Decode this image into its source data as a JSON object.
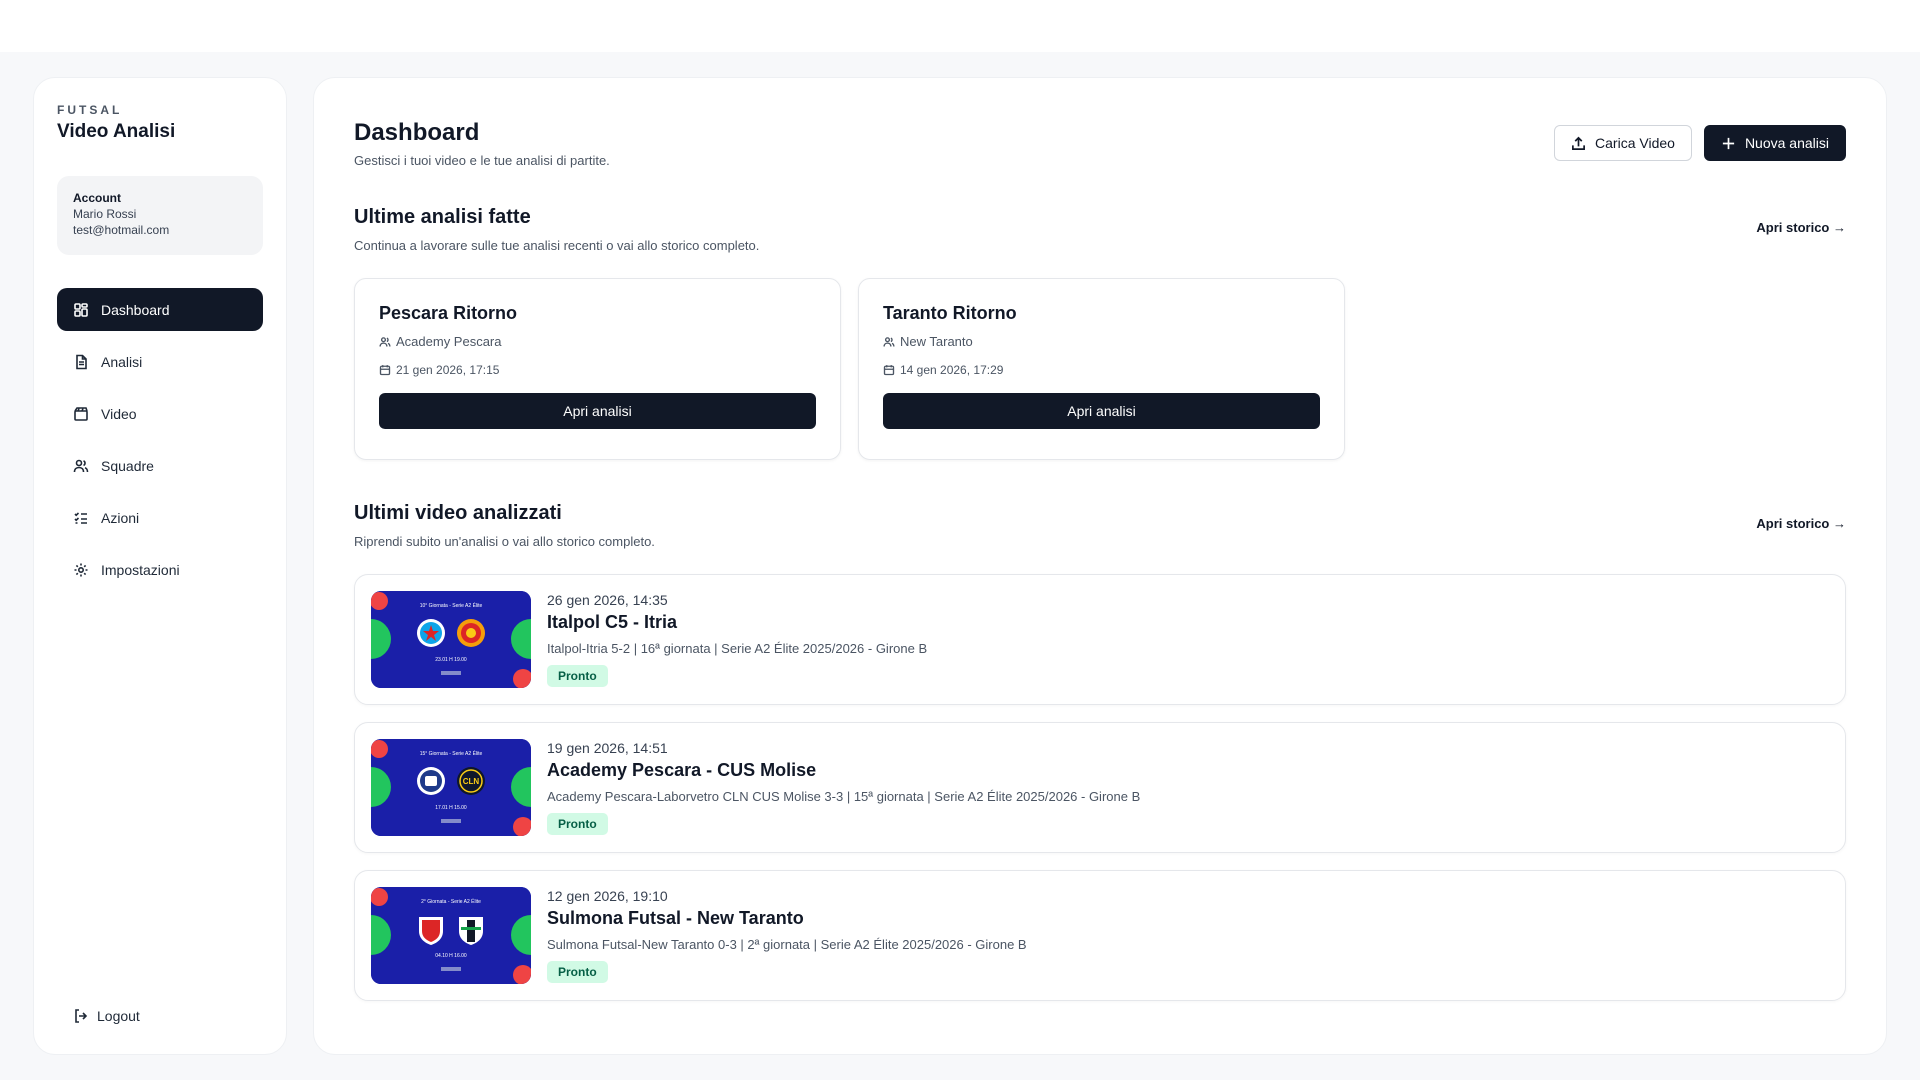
{
  "sidebar": {
    "kicker": "FUTSAL",
    "title": "Video Analisi",
    "account": {
      "label": "Account",
      "name": "Mario Rossi",
      "email": "test@hotmail.com"
    },
    "items": [
      {
        "label": "Dashboard",
        "icon": "dashboard-icon",
        "active": true
      },
      {
        "label": "Analisi",
        "icon": "document-icon"
      },
      {
        "label": "Video",
        "icon": "clapperboard-icon"
      },
      {
        "label": "Squadre",
        "icon": "users-icon"
      },
      {
        "label": "Azioni",
        "icon": "checklist-icon"
      },
      {
        "label": "Impostazioni",
        "icon": "gear-icon"
      }
    ],
    "logout_label": "Logout"
  },
  "header": {
    "title": "Dashboard",
    "subtitle": "Gestisci i tuoi video e le tue analisi di partite.",
    "upload_label": "Carica Video",
    "new_label": "Nuova analisi"
  },
  "recent_analyses": {
    "title": "Ultime analisi fatte",
    "subtitle": "Continua a lavorare sulle tue analisi recenti o vai allo storico completo.",
    "link": "Apri storico →",
    "cards": [
      {
        "title": "Pescara Ritorno",
        "team": "Academy Pescara",
        "date": "21 gen 2026, 17:15",
        "button": "Apri analisi"
      },
      {
        "title": "Taranto Ritorno",
        "team": "New Taranto",
        "date": "14 gen 2026, 17:29",
        "button": "Apri analisi"
      }
    ]
  },
  "recent_videos": {
    "title": "Ultimi video analizzati",
    "subtitle": "Riprendi subito un'analisi o vai allo storico completo.",
    "link": "Apri storico →",
    "items": [
      {
        "date": "26 gen 2026, 14:35",
        "title": "Italpol C5 - Itria",
        "desc": "Italpol-Itria 5-2 | 16ª giornata | Serie A2 Élite 2025/2026 - Girone B",
        "status": "Pronto",
        "thumb_round": "10° Giornata - Serie A2 Élite",
        "thumb_time": "23.01   H 19.00"
      },
      {
        "date": "19 gen 2026, 14:51",
        "title": "Academy Pescara - CUS Molise",
        "desc": "Academy Pescara-Laborvetro CLN CUS Molise 3-3 | 15ª giornata | Serie A2 Élite 2025/2026 - Girone B",
        "status": "Pronto",
        "thumb_round": "15° Giornata - Serie A2 Élite",
        "thumb_time": "17.01   H 15.00"
      },
      {
        "date": "12 gen 2026, 19:10",
        "title": "Sulmona Futsal - New Taranto",
        "desc": "Sulmona Futsal-New Taranto 0-3 | 2ª giornata | Serie A2 Élite 2025/2026 - Girone B",
        "status": "Pronto",
        "thumb_round": "2° Giornata - Serie A2 Élite",
        "thumb_time": "04.10   H 16.00"
      }
    ]
  },
  "colors": {
    "primary": "#111827",
    "badge_bg": "#d1fae5",
    "badge_text": "#065f46",
    "thumb_bg": "#1a1fa8"
  }
}
